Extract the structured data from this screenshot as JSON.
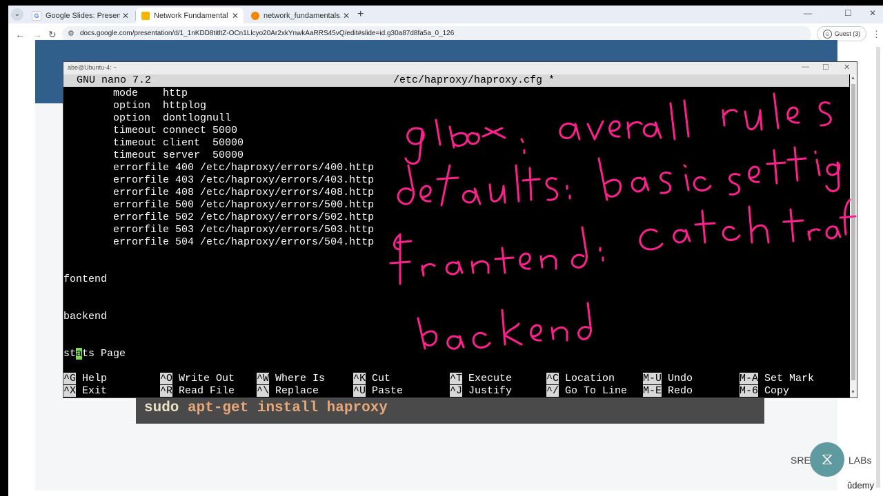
{
  "browser": {
    "tabs": [
      {
        "label": "Google Slides: Presentation Slid",
        "favicon": "G",
        "favicon_color": "#4285f4",
        "active": false
      },
      {
        "label": "Network Fundamental - Google",
        "favicon": "S",
        "favicon_color": "#f4b400",
        "active": true
      },
      {
        "label": "network_fundamentals.drawio -",
        "favicon": "D",
        "favicon_color": "#f08705",
        "active": false
      }
    ],
    "url": "docs.google.com/presentation/d/1_1nKDD8titltZ-OCn1Llcyo20Ar2xkYnwkAaRRS45vQ/edit#slide=id.g30a87d8fa5a_0_126",
    "profile_label": "Guest (3)"
  },
  "terminal": {
    "window_title": "abe@Ubuntu-4: ~",
    "nano_version": "GNU nano 7.2",
    "file_name": "/etc/haproxy/haproxy.cfg *",
    "lines": [
      "        mode    http",
      "        option  httplog",
      "        option  dontlognull",
      "        timeout connect 5000",
      "        timeout client  50000",
      "        timeout server  50000",
      "        errorfile 400 /etc/haproxy/errors/400.http",
      "        errorfile 403 /etc/haproxy/errors/403.http",
      "        errorfile 408 /etc/haproxy/errors/408.http",
      "        errorfile 500 /etc/haproxy/errors/500.http",
      "        errorfile 502 /etc/haproxy/errors/502.http",
      "        errorfile 503 /etc/haproxy/errors/503.http",
      "        errorfile 504 /etc/haproxy/errors/504.http",
      "",
      "fontend",
      "",
      "",
      "backend",
      "",
      "",
      "st",
      "a",
      "ts Page"
    ],
    "shortcuts_row1": [
      {
        "key": "^G",
        "label": "Help"
      },
      {
        "key": "^O",
        "label": "Write Out"
      },
      {
        "key": "^W",
        "label": "Where Is"
      },
      {
        "key": "^K",
        "label": "Cut"
      },
      {
        "key": "^T",
        "label": "Execute"
      },
      {
        "key": "^C",
        "label": "Location"
      },
      {
        "key": "M-U",
        "label": "Undo"
      },
      {
        "key": "M-A",
        "label": "Set Mark"
      }
    ],
    "shortcuts_row2": [
      {
        "key": "^X",
        "label": "Exit"
      },
      {
        "key": "^R",
        "label": "Read File"
      },
      {
        "key": "^\\",
        "label": "Replace"
      },
      {
        "key": "^U",
        "label": "Paste"
      },
      {
        "key": "^J",
        "label": "Justify"
      },
      {
        "key": "^/",
        "label": "Go To Line"
      },
      {
        "key": "M-E",
        "label": "Redo"
      },
      {
        "key": "M-6",
        "label": "Copy"
      }
    ]
  },
  "slide": {
    "command_part1": "sudo",
    "command_part2": " apt-get install haproxy",
    "logo_left": "SRE",
    "logo_right": "LABs",
    "watermark": "ûdemy"
  },
  "annotations": {
    "color": "#ff1f8e",
    "notes": [
      "global : overall rules",
      "defaults : basic setting",
      "frontend : catch traffic",
      "backend"
    ]
  }
}
